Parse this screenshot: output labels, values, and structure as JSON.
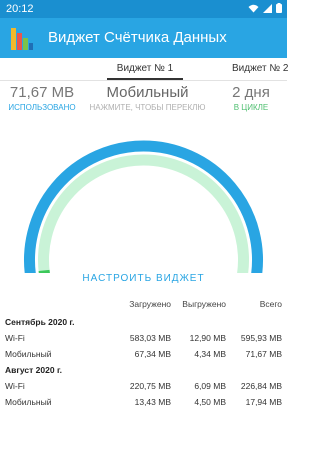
{
  "status_bar": {
    "time": "20:12"
  },
  "app_bar": {
    "title": "Виджет Счётчика Данных"
  },
  "tabs": [
    {
      "label": "Виджет № 1",
      "active": true
    },
    {
      "label": "Виджет № 2",
      "active": false
    }
  ],
  "stats": {
    "used_value": "71,67 MB",
    "used_label": "ИСПОЛЬЗОВАНО",
    "network_value": "Мобильный",
    "network_hint": "НАЖМИТЕ, ЧТОБЫ ПЕРЕКЛЮ",
    "cycle_value": "2 дня",
    "cycle_label": "В ЦИКЛЕ"
  },
  "gauge": {
    "outer_color": "#29a5e3",
    "inner_color": "#c9f3d7",
    "accent_color": "#3cc85a",
    "outer_fraction": 1.0,
    "inner_fraction": 1.0,
    "used_fraction": 0.02
  },
  "configure_button": "НАСТРОИТЬ ВИДЖЕТ",
  "table": {
    "headers": [
      "",
      "Загружено",
      "Выгружено",
      "Всего"
    ],
    "sections": [
      {
        "title": "Сентябрь 2020 г.",
        "rows": [
          [
            "Wi-Fi",
            "583,03 MB",
            "12,90 MB",
            "595,93 MB"
          ],
          [
            "Мобильный",
            "67,34 MB",
            "4,34 MB",
            "71,67 MB"
          ]
        ]
      },
      {
        "title": "Август 2020 г.",
        "rows": [
          [
            "Wi-Fi",
            "220,75 MB",
            "6,09 MB",
            "226,84 MB"
          ],
          [
            "Мобильный",
            "13,43 MB",
            "4,50 MB",
            "17,94 MB"
          ]
        ]
      }
    ]
  }
}
